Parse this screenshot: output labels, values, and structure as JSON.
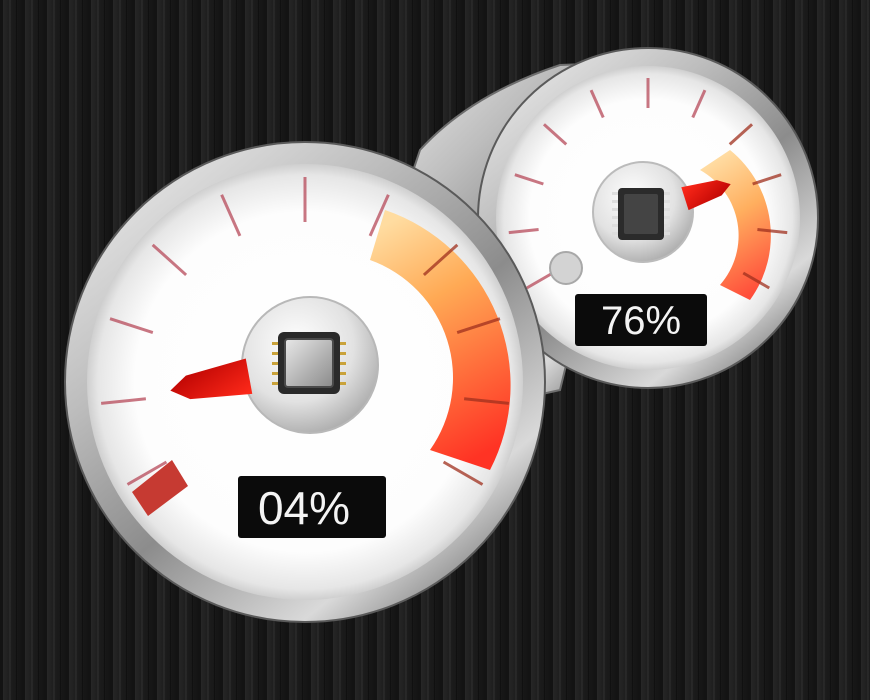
{
  "gadget": {
    "cpu_meter": {
      "readout": "04%",
      "value_percent": 4,
      "icon": "cpu-chip-icon"
    },
    "memory_meter": {
      "readout": "76%",
      "value_percent": 76,
      "icon": "memory-chip-icon"
    }
  },
  "colors": {
    "needle": "#d80000",
    "gauge_face": "#ffffff",
    "hot_zone_start": "#ffc56a",
    "hot_zone_end": "#ff3a25",
    "readout_bg": "#0b0b0b",
    "readout_text": "#f4f4f4"
  }
}
